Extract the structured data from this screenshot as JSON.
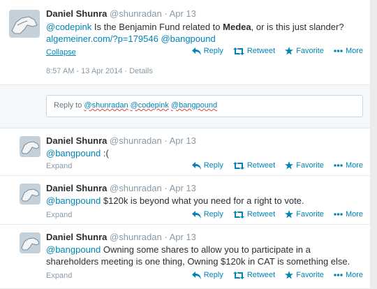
{
  "tweets": [
    {
      "fullname": "Daniel Shunra",
      "screen_name": "@shunradan",
      "separator": "·",
      "time": "Apr 13",
      "text_parts": [
        {
          "t": "@codepink",
          "k": "link"
        },
        {
          "t": " Is the Benjamin Fund related to ",
          "k": "plain"
        },
        {
          "t": "Medea",
          "k": "bold"
        },
        {
          "t": ", or is this just slander? ",
          "k": "plain"
        },
        {
          "t": "algemeiner.com/?p=179546",
          "k": "link"
        },
        {
          "t": " ",
          "k": "plain"
        },
        {
          "t": "@bangpound",
          "k": "link"
        }
      ],
      "toggle_label": "Collapse",
      "details": "8:57 AM - 13 Apr 2014 · Details"
    },
    {
      "fullname": "Daniel Shunra",
      "screen_name": "@shunradan",
      "separator": "·",
      "time": "Apr 13",
      "mention": "@bangpound",
      "body": " :(",
      "toggle_label": "Expand"
    },
    {
      "fullname": "Daniel Shunra",
      "screen_name": "@shunradan",
      "separator": "·",
      "time": "Apr 13",
      "mention": "@bangpound",
      "body": " $120k is beyond what you need for a right to vote.",
      "toggle_label": "Expand"
    },
    {
      "fullname": "Daniel Shunra",
      "screen_name": "@shunradan",
      "separator": "·",
      "time": "Apr 13",
      "mention": "@bangpound",
      "body": " Owning some shares to allow you to participate in a shareholders meeting is one thing, Owning $120k in CAT is something else.",
      "toggle_label": "Expand"
    }
  ],
  "actions": {
    "reply": "Reply",
    "retweet": "Retweet",
    "favorite": "Favorite",
    "more": "More"
  },
  "reply_box": {
    "prefix": "Reply to ",
    "mentions": [
      "@shunradan",
      "@codepink",
      "@bangpound"
    ]
  },
  "colors": {
    "link": "#0084b4",
    "muted": "#8899a6",
    "background": "#ffffff"
  },
  "icons": [
    "reply-icon",
    "retweet-icon",
    "favorite-star-icon",
    "more-dots-icon",
    "avatar-drawing"
  ]
}
